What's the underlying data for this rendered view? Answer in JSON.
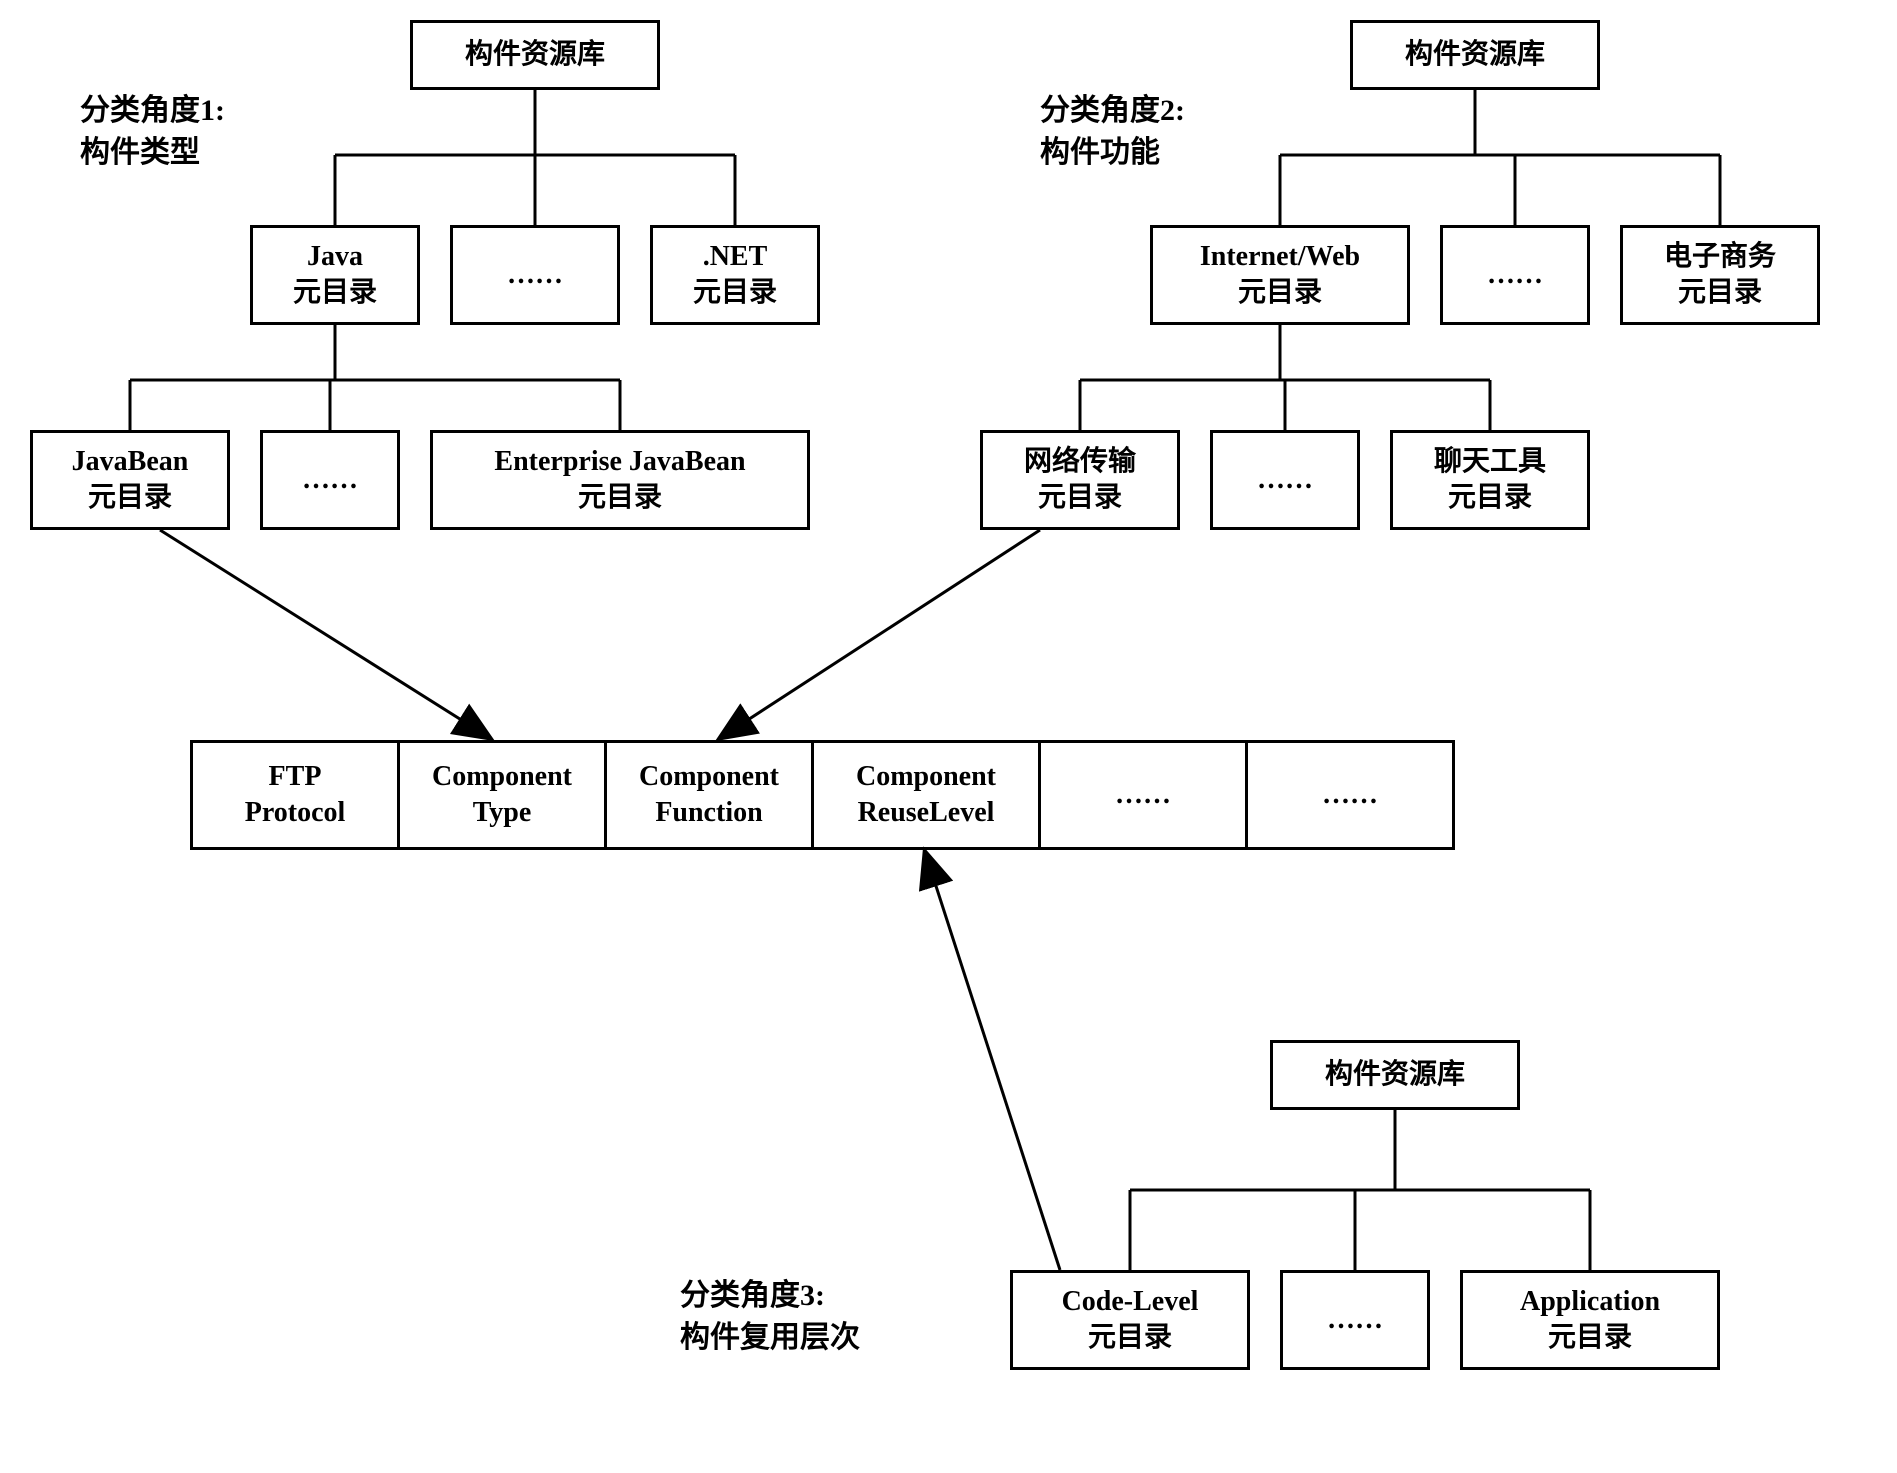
{
  "labels": {
    "perspective1": "分类角度1:\n构件类型",
    "perspective2": "分类角度2:\n构件功能",
    "perspective3": "分类角度3:\n构件复用层次"
  },
  "top": {
    "left_root": "构件资源库",
    "right_root": "构件资源库"
  },
  "left_l1": {
    "java": "Java\n元目录",
    "dots": "……",
    "net": ".NET\n元目录"
  },
  "left_l2": {
    "javabean": "JavaBean\n元目录",
    "dots": "……",
    "ejb": "Enterprise JavaBean\n元目录"
  },
  "right_l1": {
    "internet": "Internet/Web\n元目录",
    "dots": "……",
    "ecommerce": "电子商务\n元目录"
  },
  "right_l2": {
    "network": "网络传输\n元目录",
    "dots": "……",
    "chat": "聊天工具\n元目录"
  },
  "row": {
    "ftp": "FTP\nProtocol",
    "ctype": "Component\nType",
    "cfunc": "Component\nFunction",
    "creuse": "Component\nReuseLevel",
    "dots1": "……",
    "dots2": "……"
  },
  "bottom": {
    "root": "构件资源库",
    "code": "Code-Level\n元目录",
    "dots": "……",
    "app": "Application\n元目录"
  }
}
